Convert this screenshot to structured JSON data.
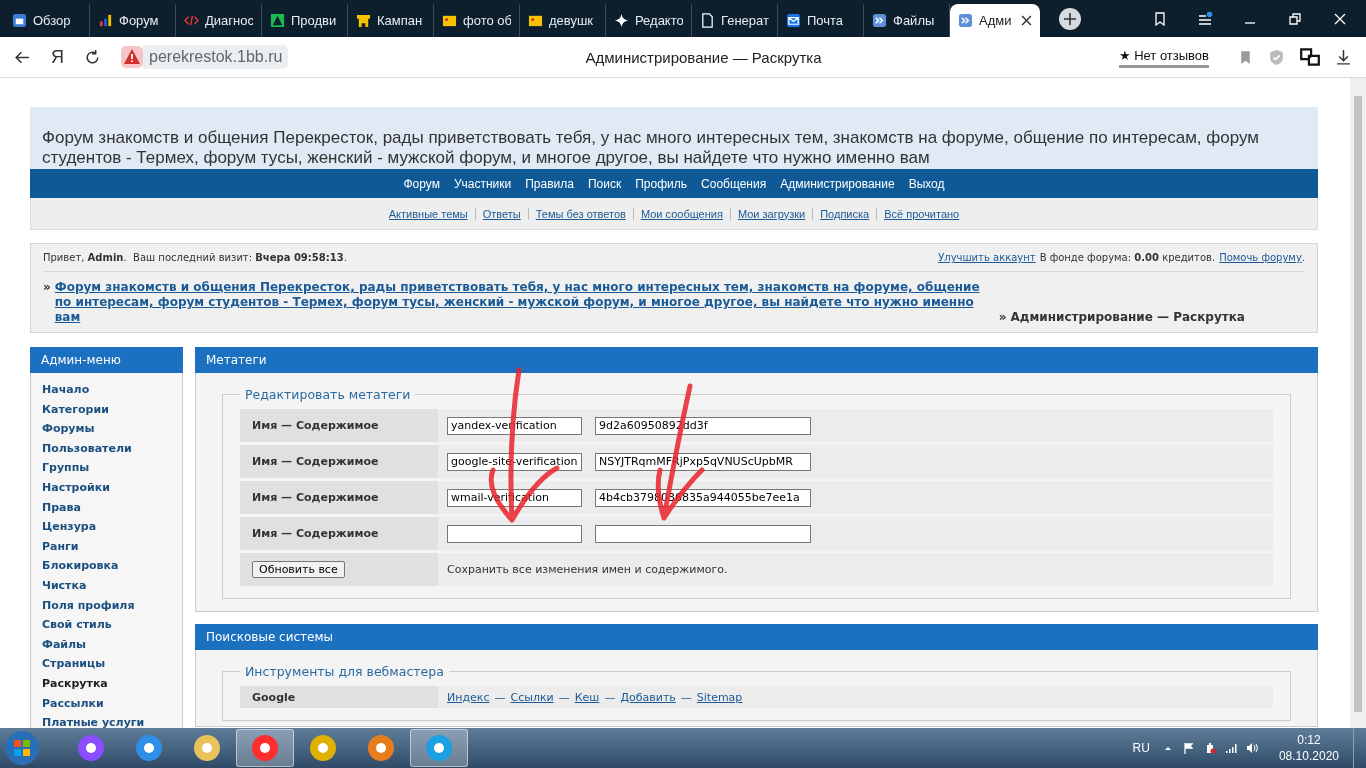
{
  "browser": {
    "tabs": [
      {
        "label": "Обзор",
        "kind": "overview",
        "selected": false
      },
      {
        "label": "Форум",
        "kind": "chart",
        "selected": false
      },
      {
        "label": "Диагнос",
        "kind": "code",
        "selected": false
      },
      {
        "label": "Продви",
        "kind": "triangle",
        "selected": false
      },
      {
        "label": "Кампан",
        "kind": "banner",
        "selected": false
      },
      {
        "label": "фото об",
        "kind": "image",
        "selected": false
      },
      {
        "label": "девушк",
        "kind": "image",
        "selected": false
      },
      {
        "label": "Редакто",
        "kind": "sparkle",
        "selected": false
      },
      {
        "label": "Генерат",
        "kind": "doc",
        "selected": false
      },
      {
        "label": "Почта",
        "kind": "mail",
        "selected": false
      },
      {
        "label": "Файлы",
        "kind": "files",
        "selected": false
      },
      {
        "label": "Адми",
        "kind": "files",
        "selected": true
      }
    ],
    "logo": "Я",
    "url": "perekrestok.1bb.ru",
    "page_title": "Администрирование — Раскрутка",
    "reviews": "★ Нет отзывов"
  },
  "banner": "Форум знакомств и общения Перекресток, рады приветствовать тебя, у нас много интересных тем, знакомств на форуме, общение по интересам, форум студентов - Термех, форум тусы, женский - мужской форум, и многое другое, вы найдете что нужно именно вам",
  "nav": [
    "Форум",
    "Участники",
    "Правила",
    "Поиск",
    "Профиль",
    "Сообщения",
    "Администрирование",
    "Выход"
  ],
  "subnav": [
    "Активные темы",
    "Ответы",
    "Темы без ответов",
    "Мои сообщения",
    "Мои загрузки",
    "Подписка",
    "Всё прочитано"
  ],
  "welcome": {
    "greeting": "Привет, **Admin**.  Ваш последний визит: **Вчера 09:58:13**.",
    "upgrade_link": "Улучшить аккаунт",
    "fund": "В фонде форума: **0.00** кредитов.",
    "help_link": "Помочь форуму",
    "help_suffix": "."
  },
  "breadcrumb": {
    "marker": "»",
    "forum_link": "Форум знакомств и общения Перекресток, рады приветствовать тебя, у нас много интересных тем, знакомств на форуме, общение по интересам, форум студентов - Термех, форум тусы, женский - мужской форум, и многое другое, вы найдете что нужно именно вам",
    "separator": "»",
    "current": "Администрирование — Раскрутка"
  },
  "sidebar": {
    "title": "Админ-меню",
    "items": [
      {
        "label": "Начало",
        "selected": false
      },
      {
        "label": "Категории",
        "selected": false
      },
      {
        "label": "Форумы",
        "selected": false
      },
      {
        "label": "Пользователи",
        "selected": false
      },
      {
        "label": "Группы",
        "selected": false
      },
      {
        "label": "Настройки",
        "selected": false
      },
      {
        "label": "Права",
        "selected": false
      },
      {
        "label": "Цензура",
        "selected": false
      },
      {
        "label": "Ранги",
        "selected": false
      },
      {
        "label": "Блокировка",
        "selected": false
      },
      {
        "label": "Чистка",
        "selected": false
      },
      {
        "label": "Поля профиля",
        "selected": false
      },
      {
        "label": "Свой стиль",
        "selected": false
      },
      {
        "label": "Файлы",
        "selected": false
      },
      {
        "label": "Страницы",
        "selected": false
      },
      {
        "label": "Раскрутка",
        "selected": true
      },
      {
        "label": "Рассылки",
        "selected": false
      },
      {
        "label": "Платные услуги",
        "selected": false
      }
    ]
  },
  "metatags": {
    "title": "Метатеги",
    "legend": "Редактировать метатеги",
    "rows": [
      {
        "label": "Имя — Содержимое",
        "name": "yandex-verification",
        "content": "9d2a60950892dd3f"
      },
      {
        "label": "Имя — Содержимое",
        "name": "google-site-verification",
        "content": "NSYJTRqmMFRjPxp5qVNUScUpbMR"
      },
      {
        "label": "Имя — Содержимое",
        "name": "wmail-verification",
        "content": "4b4cb3798036835a944055be7ee1a"
      },
      {
        "label": "Имя — Содержимое"
      }
    ],
    "button": "Обновить все",
    "note": "Сохранить все изменения имен и содержимого."
  },
  "search_engines": {
    "title": "Поисковые системы",
    "legend": "Инструменты для вебмастера",
    "rows": [
      {
        "label": "Google",
        "links": [
          "Индекс",
          "Ссылки",
          "Кеш",
          "Добавить",
          "Sitemap"
        ]
      }
    ],
    "separator": "—"
  },
  "taskbar": {
    "apps": [
      {
        "kind": "alice",
        "selected": false
      },
      {
        "kind": "ie",
        "selected": false
      },
      {
        "kind": "folder",
        "selected": false
      },
      {
        "kind": "yandex",
        "selected": true
      },
      {
        "kind": "chrome",
        "selected": false
      },
      {
        "kind": "player",
        "selected": false
      },
      {
        "kind": "skype",
        "selected": true
      }
    ],
    "language": "RU",
    "time": "0:12",
    "date": "08.10.2020"
  }
}
